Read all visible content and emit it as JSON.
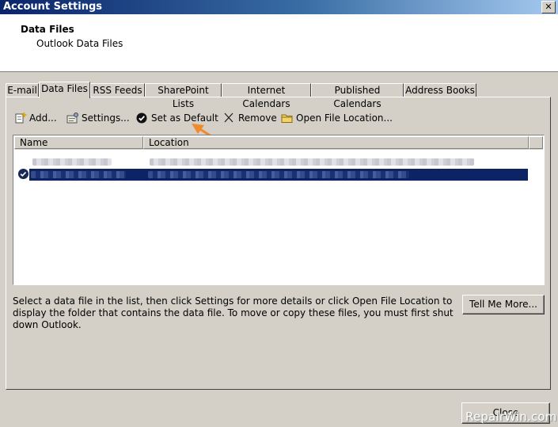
{
  "window": {
    "title": "Account Settings",
    "close_glyph": "✕"
  },
  "header": {
    "heading": "Data Files",
    "subheading": "Outlook Data Files"
  },
  "tabs": [
    {
      "label": "E-mail"
    },
    {
      "label": "Data Files",
      "active": true
    },
    {
      "label": "RSS Feeds"
    },
    {
      "label": "SharePoint Lists"
    },
    {
      "label": "Internet Calendars"
    },
    {
      "label": "Published Calendars"
    },
    {
      "label": "Address Books"
    }
  ],
  "toolbar": {
    "add_label": "Add...",
    "settings_label": "Settings...",
    "set_default_label": "Set as Default",
    "remove_label": "Remove",
    "open_location_label": "Open File Location..."
  },
  "list": {
    "columns": [
      "Name",
      "Location"
    ],
    "selected_row": 2
  },
  "description": "Select a data file in the list, then click Settings for more details or click Open File Location to display the folder that contains the data file. To move or copy these files, you must first shut down Outlook.",
  "buttons": {
    "tell_me_more": "Tell Me More...",
    "close": "Close"
  },
  "watermark": "RepairWin.com",
  "colors": {
    "titlebar_start": "#0a246a",
    "selection": "#0c2466",
    "arrow": "#f08a2a"
  }
}
